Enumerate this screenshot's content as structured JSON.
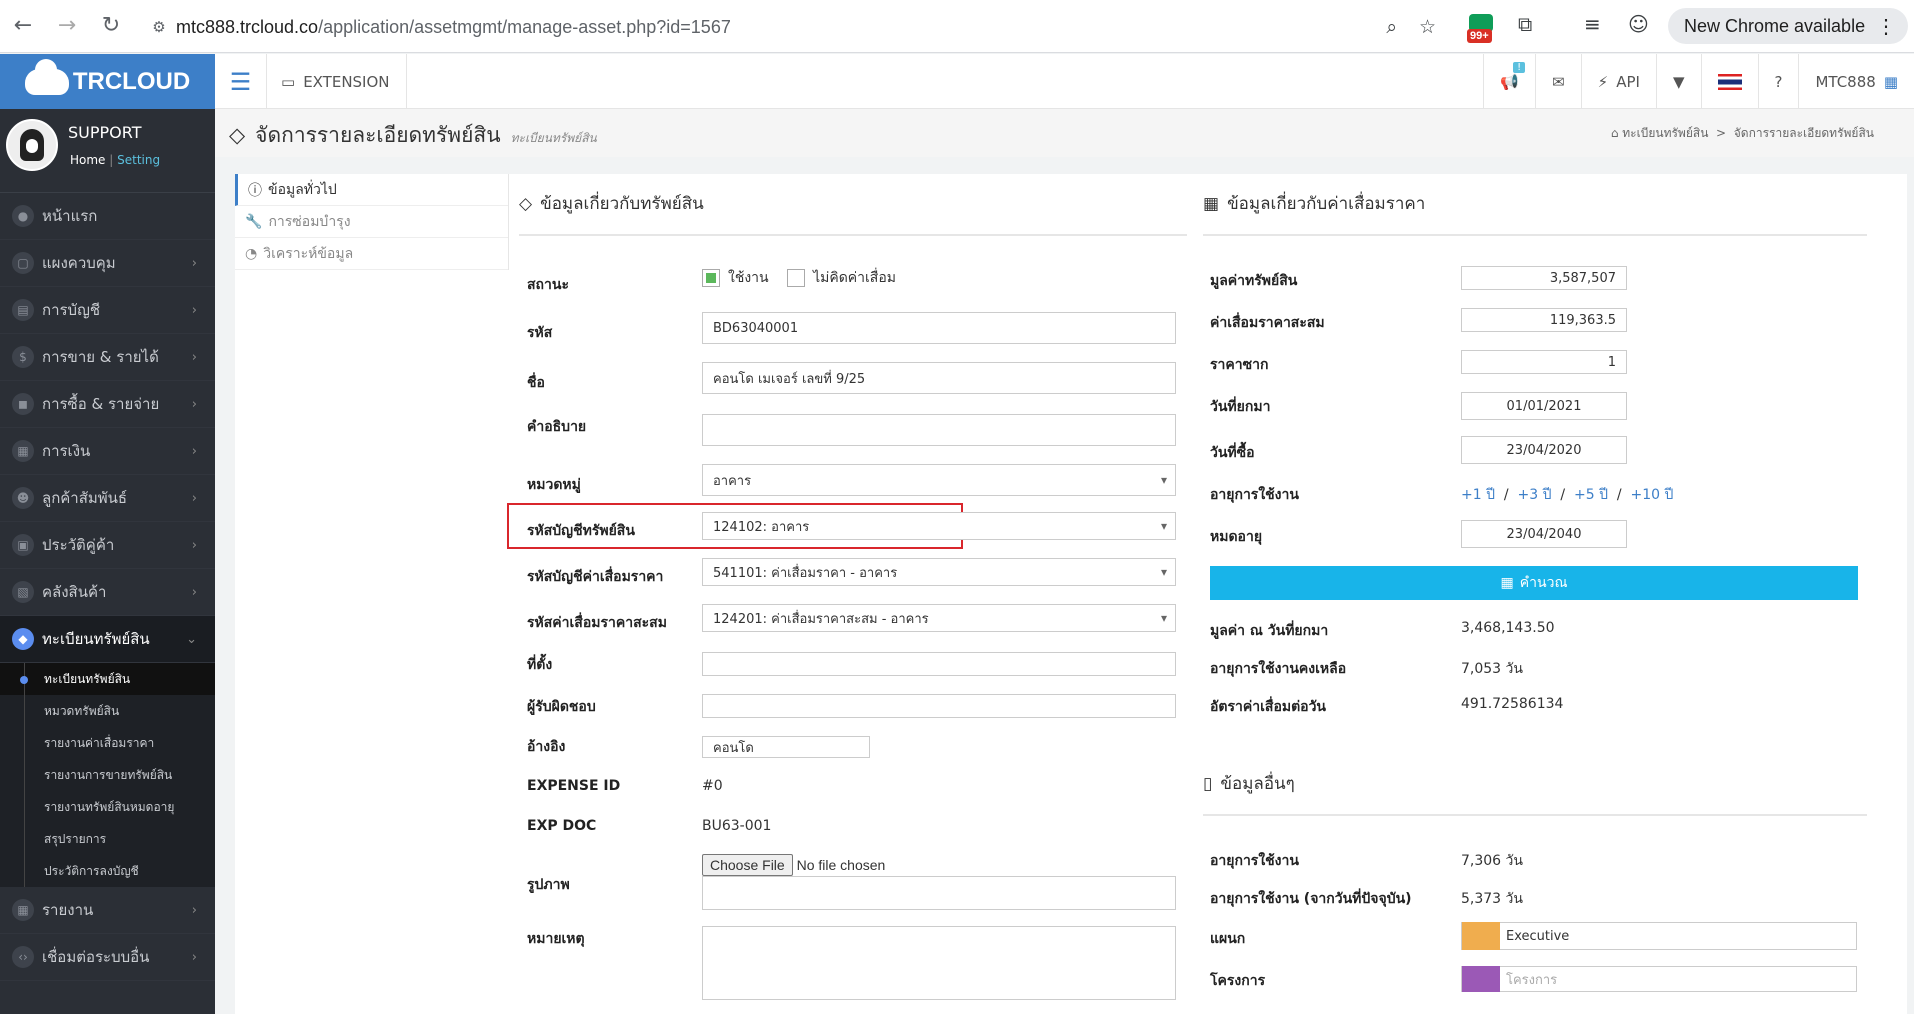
{
  "browser": {
    "url_host": "mtc888.trcloud.co",
    "url_path": "/application/assetmgmt/manage-asset.php?id=1567",
    "ext_badge": "99+",
    "new_chrome": "New Chrome available"
  },
  "app": {
    "logo_text": "TRCLOUD",
    "extension_label": "EXTENSION",
    "api_label": "API",
    "company": "MTC888",
    "notif_badge": "!"
  },
  "profile": {
    "name": "SUPPORT",
    "home": "Home",
    "sep": "|",
    "setting": "Setting"
  },
  "sidebar": {
    "items": [
      {
        "label": "หน้าแรก",
        "chev": ""
      },
      {
        "label": "แผงควบคุม",
        "chev": "›"
      },
      {
        "label": "การบัญชี",
        "chev": "›"
      },
      {
        "label": "การขาย & รายได้",
        "chev": "›"
      },
      {
        "label": "การซื้อ & รายจ่าย",
        "chev": "›"
      },
      {
        "label": "การเงิน",
        "chev": "›"
      },
      {
        "label": "ลูกค้าสัมพันธ์",
        "chev": "›"
      },
      {
        "label": "ประวัติคู่ค้า",
        "chev": "›"
      },
      {
        "label": "คลังสินค้า",
        "chev": "›"
      }
    ],
    "active": {
      "label": "ทะเบียนทรัพย์สิน",
      "chev": "⌄"
    },
    "sub": [
      "ทะเบียนทรัพย์สิน",
      "หมวดทรัพย์สิน",
      "รายงานค่าเสื่อมราคา",
      "รายงานการขายทรัพย์สิน",
      "รายงานทรัพย์สินหมดอายุ",
      "สรุปรายการ",
      "ประวัติการลงบัญชี"
    ],
    "after": [
      {
        "label": "รายงาน",
        "chev": "›"
      },
      {
        "label": "เชื่อมต่อระบบอื่น",
        "chev": "›"
      }
    ]
  },
  "page": {
    "title": "จัดการรายละเอียดทรัพย์สิน",
    "subtitle": "ทะเบียนทรัพย์สิน",
    "crumb1": "ทะเบียนทรัพย์สิน",
    "crumb_sep": ">",
    "crumb2": "จัดการรายละเอียดทรัพย์สิน"
  },
  "subnav": [
    "ข้อมูลทั่วไป",
    "การซ่อมบำรุง",
    "วิเคราะห์ข้อมูล"
  ],
  "asset": {
    "title": "ข้อมูลเกี่ยวกับทรัพย์สิน",
    "status_label": "สถานะ",
    "status_active": "ใช้งาน",
    "status_nodep": "ไม่คิดค่าเสื่อม",
    "code_label": "รหัส",
    "code": "BD63040001",
    "name_label": "ชื่อ",
    "name": "คอนโด เมเจอร์ เลขที่ 9/25",
    "desc_label": "คำอธิบาย",
    "desc": "",
    "cat_label": "หมวดหมู่",
    "cat": "อาคาร",
    "acc_label": "รหัสบัญชีทรัพย์สิน",
    "acc": "124102: อาคาร",
    "depacc_label": "รหัสบัญชีค่าเสื่อมราคา",
    "depacc": "541101: ค่าเสื่อมราคา - อาคาร",
    "accum_label": "รหัสค่าเสื่อมราคาสะสม",
    "accum": "124201: ค่าเสื่อมราคาสะสม - อาคาร",
    "loc_label": "ที่ตั้ง",
    "loc": "",
    "owner_label": "ผู้รับผิดชอบ",
    "owner": "",
    "ref_label": "อ้างอิง",
    "ref": "คอนโด",
    "expid_label": "EXPENSE ID",
    "expid": "#0",
    "expdoc_label": "EXP DOC",
    "expdoc": "BU63-001",
    "img_label": "รูปภาพ",
    "choose_file": "Choose File",
    "no_file": "No file chosen",
    "note_label": "หมายเหตุ"
  },
  "dep": {
    "title": "ข้อมูลเกี่ยวกับค่าเสื่อมราคา",
    "value_label": "มูลค่าทรัพย์สิน",
    "value": "3,587,507",
    "accum_label": "ค่าเสื่อมราคาสะสม",
    "accum": "119,363.5",
    "salvage_label": "ราคาซาก",
    "salvage": "1",
    "bf_label": "วันที่ยกมา",
    "bf": "01/01/2021",
    "buy_label": "วันที่ซื้อ",
    "buy": "23/04/2020",
    "life_label": "อายุการใช้งาน",
    "life_links": [
      "+1 ปี",
      "+3 ปี",
      "+5 ปี",
      "+10 ปี"
    ],
    "life_sep": "/",
    "exp_label": "หมดอายุ",
    "exp": "23/04/2040",
    "calc": "คำนวณ",
    "val_bf_label": "มูลค่า ณ วันที่ยกมา",
    "val_bf": "3,468,143.50",
    "remain_label": "อายุการใช้งานคงเหลือ",
    "remain": "7,053 วัน",
    "rate_label": "อัตราค่าเสื่อมต่อวัน",
    "rate": "491.72586134"
  },
  "other": {
    "title": "ข้อมูลอื่นๆ",
    "life_label": "อายุการใช้งาน",
    "life": "7,306 วัน",
    "life_now_label": "อายุการใช้งาน (จากวันที่ปัจจุบัน)",
    "life_now": "5,373 วัน",
    "dept_label": "แผนก",
    "dept": "Executive",
    "proj_label": "โครงการ",
    "proj_placeholder": "โครงการ"
  },
  "colors": {
    "brand": "#3d7fc8",
    "calc": "#18b4e9",
    "highlight": "#d9262c",
    "dept_tag": "#f0ad4e",
    "proj_tag": "#9b59b6"
  }
}
